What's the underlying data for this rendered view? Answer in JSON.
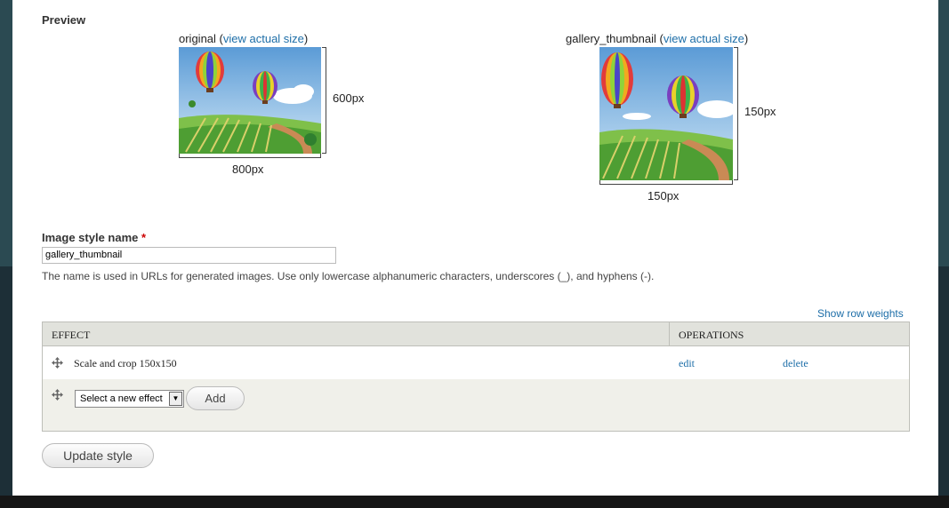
{
  "preview": {
    "title": "Preview",
    "original": {
      "name": "original",
      "link": "view actual size",
      "height_label": "600px",
      "width_label": "800px"
    },
    "derivative": {
      "name": "gallery_thumbnail",
      "link": "view actual size",
      "height_label": "150px",
      "width_label": "150px"
    }
  },
  "form": {
    "label": "Image style name",
    "required_mark": "*",
    "value": "gallery_thumbnail",
    "help": "The name is used in URLs for generated images. Use only lowercase alphanumeric characters, underscores (_), and hyphens (-)."
  },
  "table": {
    "row_weights_link": "Show row weights",
    "headers": [
      "Effect",
      "Operations"
    ],
    "rows": [
      {
        "effect": "Scale and crop 150x150",
        "edit": "edit",
        "delete": "delete"
      }
    ],
    "new_effect": {
      "select_value": "Select a new effect",
      "add_label": "Add"
    }
  },
  "actions": {
    "update_label": "Update style"
  },
  "colors": {
    "link": "#1d6ea8",
    "required": "#cc0000",
    "table_header": "#e1e2dc"
  }
}
